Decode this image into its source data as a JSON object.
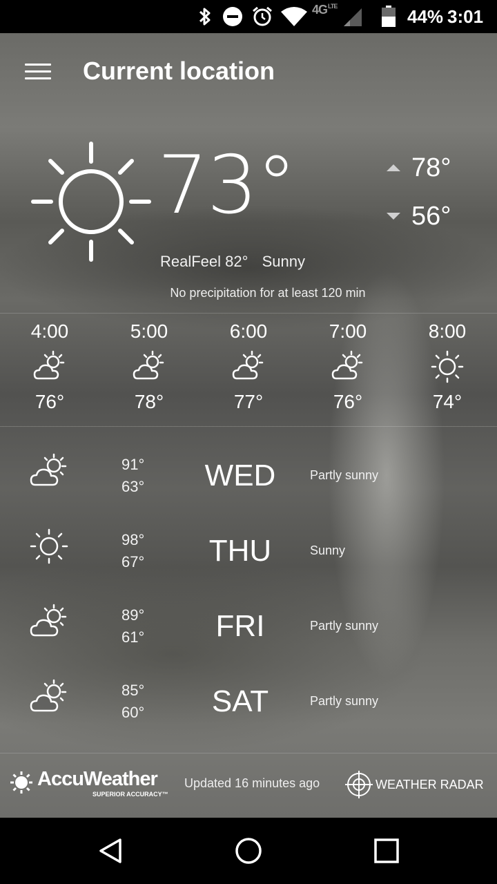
{
  "status_bar": {
    "network": "4G",
    "network_sub": "LTE",
    "battery": "44%",
    "time": "3:01",
    "icons": [
      "bluetooth-icon",
      "do-not-disturb-icon",
      "alarm-icon",
      "wifi-icon",
      "signal-icon",
      "battery-icon"
    ]
  },
  "header": {
    "title": "Current location",
    "menu_icon": "menu-icon"
  },
  "current": {
    "temp": "73°",
    "high": "78°",
    "low": "56°",
    "realfeel": "RealFeel 82°",
    "condition": "Sunny",
    "precip": "No precipitation for at least 120 min",
    "icon": "sun-icon"
  },
  "hourly": [
    {
      "time": "4:00",
      "temp": "76°",
      "icon": "partly-sunny-icon"
    },
    {
      "time": "5:00",
      "temp": "78°",
      "icon": "partly-sunny-icon"
    },
    {
      "time": "6:00",
      "temp": "77°",
      "icon": "partly-sunny-icon"
    },
    {
      "time": "7:00",
      "temp": "76°",
      "icon": "partly-sunny-icon"
    },
    {
      "time": "8:00",
      "temp": "74°",
      "icon": "sun-icon"
    }
  ],
  "daily": [
    {
      "day": "WED",
      "high": "91°",
      "low": "63°",
      "condition": "Partly sunny",
      "icon": "partly-sunny-icon"
    },
    {
      "day": "THU",
      "high": "98°",
      "low": "67°",
      "condition": "Sunny",
      "icon": "sun-icon"
    },
    {
      "day": "FRI",
      "high": "89°",
      "low": "61°",
      "condition": "Partly sunny",
      "icon": "partly-sunny-icon"
    },
    {
      "day": "SAT",
      "high": "85°",
      "low": "60°",
      "condition": "Partly sunny",
      "icon": "partly-sunny-icon"
    }
  ],
  "footer": {
    "brand": "AccuWeather",
    "tagline": "SUPERIOR ACCURACY™",
    "updated": "Updated 16 minutes ago",
    "radar": "WEATHER RADAR"
  },
  "colors": {
    "status_bar": "#000000",
    "nav_bar": "#000000",
    "text": "#ffffff"
  }
}
